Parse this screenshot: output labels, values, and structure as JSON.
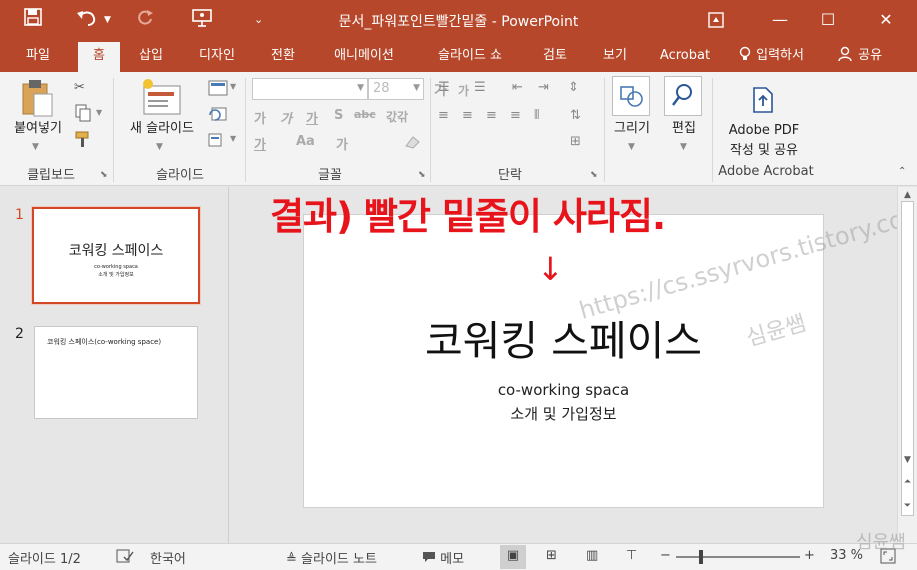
{
  "window": {
    "title": "문서_파워포인트빨간밑줄 - PowerPoint",
    "save_icon": "save-icon",
    "undo_icon": "undo-icon",
    "redo_icon": "redo-icon",
    "present_icon": "present-from-start-icon",
    "customize_icon": "customize-qat-icon",
    "ribbon_display_icon": "ribbon-display-options-icon",
    "minimize_glyph": "—",
    "maximize_glyph": "☐",
    "close_glyph": "✕"
  },
  "tabs": {
    "file": "파일",
    "home": "홈",
    "insert": "삽입",
    "design": "디자인",
    "transitions": "전환",
    "animations": "애니메이션",
    "slideshow": "슬라이드 쇼",
    "review": "검토",
    "view": "보기",
    "acrobat": "Acrobat",
    "tell_me": "입력하서",
    "share": "공유",
    "active_color": "#b7472a"
  },
  "ribbon": {
    "clipboard": {
      "paste": "붙여넣기",
      "group": "클립보드"
    },
    "slides": {
      "new_slide": "새 슬라이드",
      "group": "슬라이드"
    },
    "font": {
      "size": "28",
      "group": "글꼴"
    },
    "paragraph": {
      "group": "단락"
    },
    "drawing": {
      "label": "그리기"
    },
    "editing": {
      "label": "편집"
    },
    "acrobat": {
      "line1": "Adobe PDF",
      "line2": "작성 및 공유",
      "group": "Adobe Acrobat"
    }
  },
  "thumbnails": [
    {
      "num": "1",
      "title": "코워킹 스페이스",
      "sub1": "co-working spaca",
      "sub2": "소개 및 가입정보"
    },
    {
      "num": "2",
      "title": "코워킹 스페이스(co-working space)"
    }
  ],
  "slide": {
    "title": "코워킹 스페이스",
    "subtitle_line1": "co-working spaca",
    "subtitle_line2": "소개 및 가입정보"
  },
  "annotation": {
    "text": "결과) 빨간 밑줄이 사라짐.",
    "arrow": "↓",
    "color": "#e8141c"
  },
  "watermark": {
    "url": "https://cs.ssyrvors.tistory.com",
    "name": "심윤쌤"
  },
  "statusbar": {
    "slide_counter": "슬라이드 1/2",
    "language": "한국어",
    "notes": "슬라이드 노트",
    "comments": "메모",
    "zoom": "33 %",
    "zoom_level_fraction": 0.33
  }
}
